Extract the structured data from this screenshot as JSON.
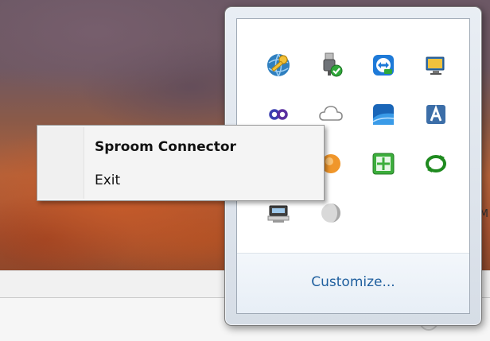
{
  "context_menu": {
    "items": [
      {
        "label": "Sproom Connector",
        "bold": true
      },
      {
        "label": "Exit",
        "bold": false
      }
    ]
  },
  "tray_flyout": {
    "customize_label": "Customize...",
    "icons": [
      "key-globe-icon",
      "usb-safely-remove-icon",
      "teamviewer-icon",
      "display-icon",
      "infinity-link-icon",
      "cloud-icon",
      "blue-wave-icon",
      "a-letter-icon",
      "orange-circle-icon",
      "green-shield-icon",
      "green-sync-icon",
      "network-monitor-icon",
      "gray-circle-icon"
    ]
  },
  "background": {
    "fragment_text": "M"
  }
}
